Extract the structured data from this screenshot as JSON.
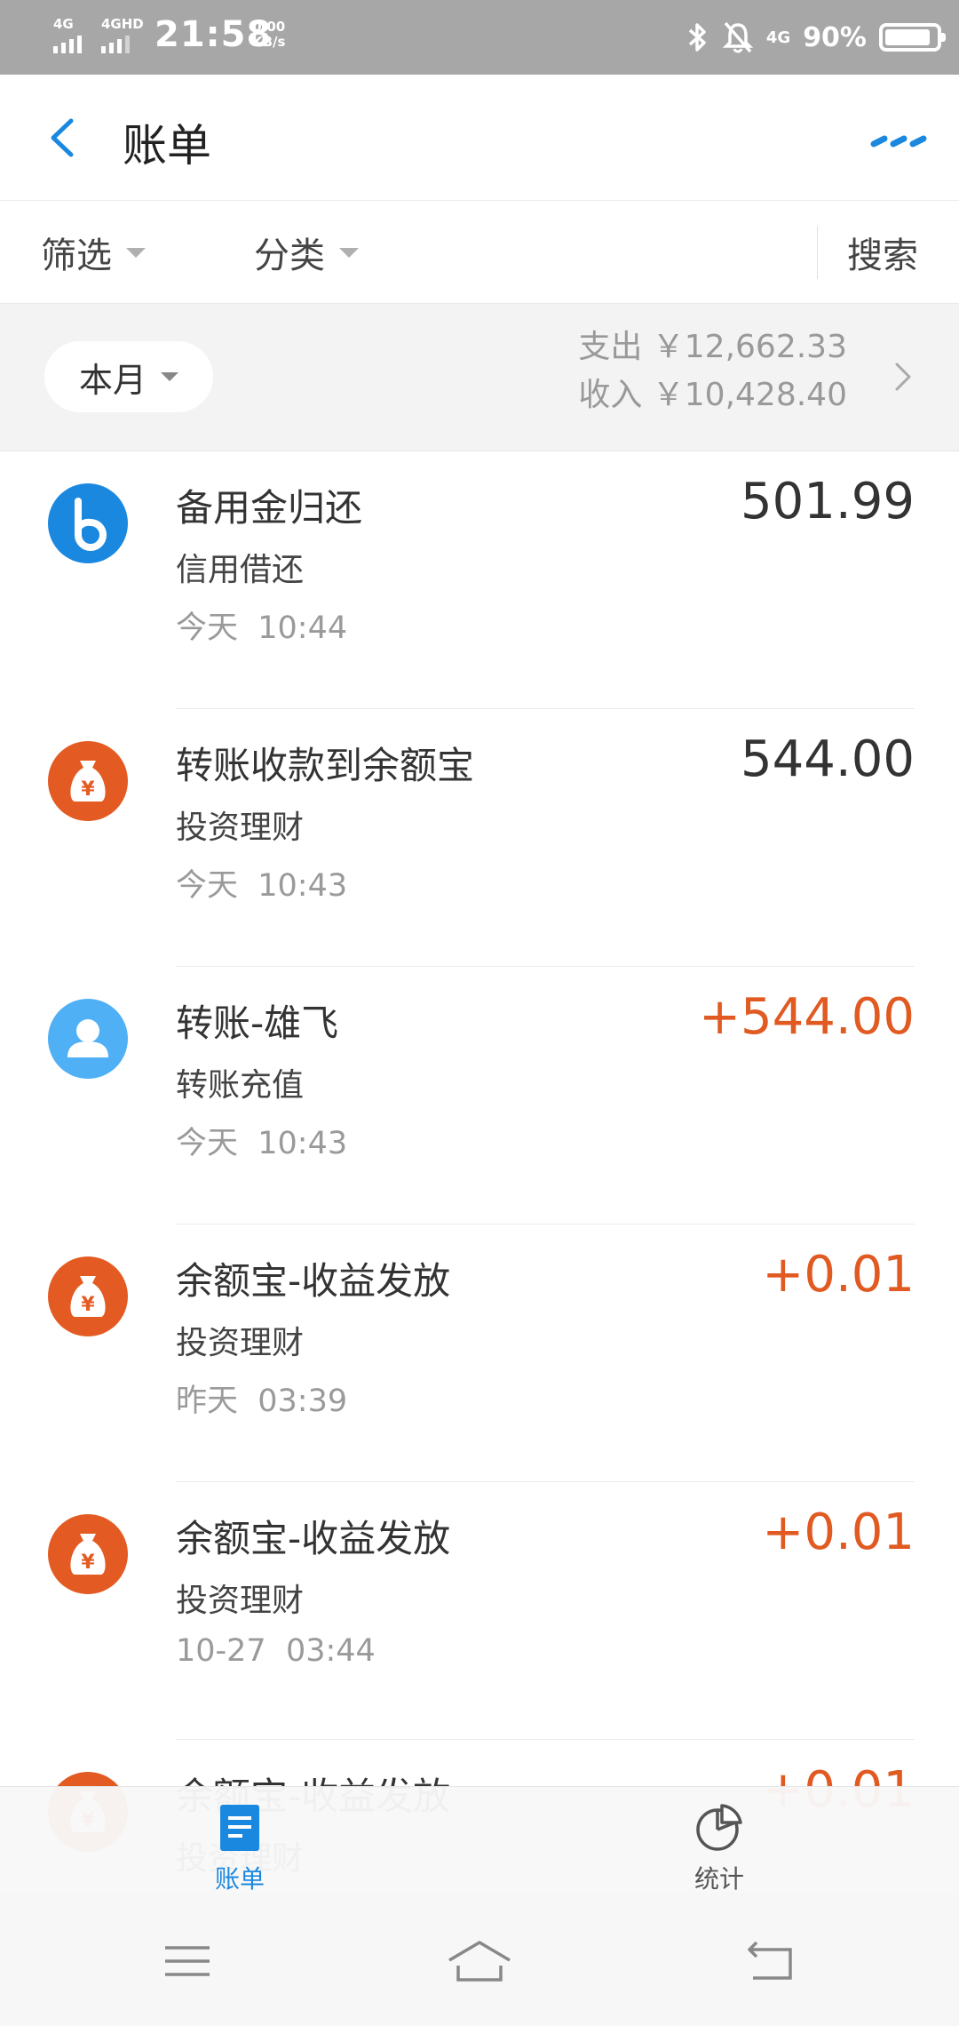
{
  "status_bar": {
    "sim1": "4G",
    "sim2": "4GHD",
    "time": "21:58",
    "speed_value": "0.00",
    "speed_unit": "KB/s",
    "right_network": "4G",
    "battery": "90%",
    "battery_level": 0.9
  },
  "header": {
    "title": "账单"
  },
  "filters": {
    "filter_label": "筛选",
    "category_label": "分类",
    "search_label": "搜索"
  },
  "summary": {
    "period": "本月",
    "expense": "支出 ￥12,662.33",
    "income": "收入 ￥10,428.40"
  },
  "transactions": [
    {
      "icon": "b-logo-icon",
      "icon_color": "#1b88e0",
      "title": "备用金归还",
      "category": "信用借还",
      "time": "今天  10:44",
      "amount": "501.99",
      "type": "expense"
    },
    {
      "icon": "money-bag-icon",
      "icon_color": "#e35b22",
      "title": "转账收款到余额宝",
      "category": "投资理财",
      "time": "今天  10:43",
      "amount": "544.00",
      "type": "expense"
    },
    {
      "icon": "person-icon",
      "icon_color": "#4fb0f5",
      "title": "转账-雄飞",
      "category": "转账充值",
      "time": "今天  10:43",
      "amount": "+544.00",
      "type": "income"
    },
    {
      "icon": "money-bag-icon",
      "icon_color": "#e35b22",
      "title": "余额宝-收益发放",
      "category": "投资理财",
      "time": "昨天  03:39",
      "amount": "+0.01",
      "type": "income"
    },
    {
      "icon": "money-bag-icon",
      "icon_color": "#e35b22",
      "title": "余额宝-收益发放",
      "category": "投资理财",
      "time": "10-27  03:44",
      "amount": "+0.01",
      "type": "income"
    },
    {
      "icon": "money-bag-icon",
      "icon_color": "#e35b22",
      "title": "余额宝-收益发放",
      "category": "投资理财",
      "time": "",
      "amount": "+0.01",
      "type": "income"
    }
  ],
  "tabs": {
    "bills_label": "账单",
    "stats_label": "统计"
  },
  "colors": {
    "accent": "#1b88e0",
    "income": "#e05a21"
  }
}
